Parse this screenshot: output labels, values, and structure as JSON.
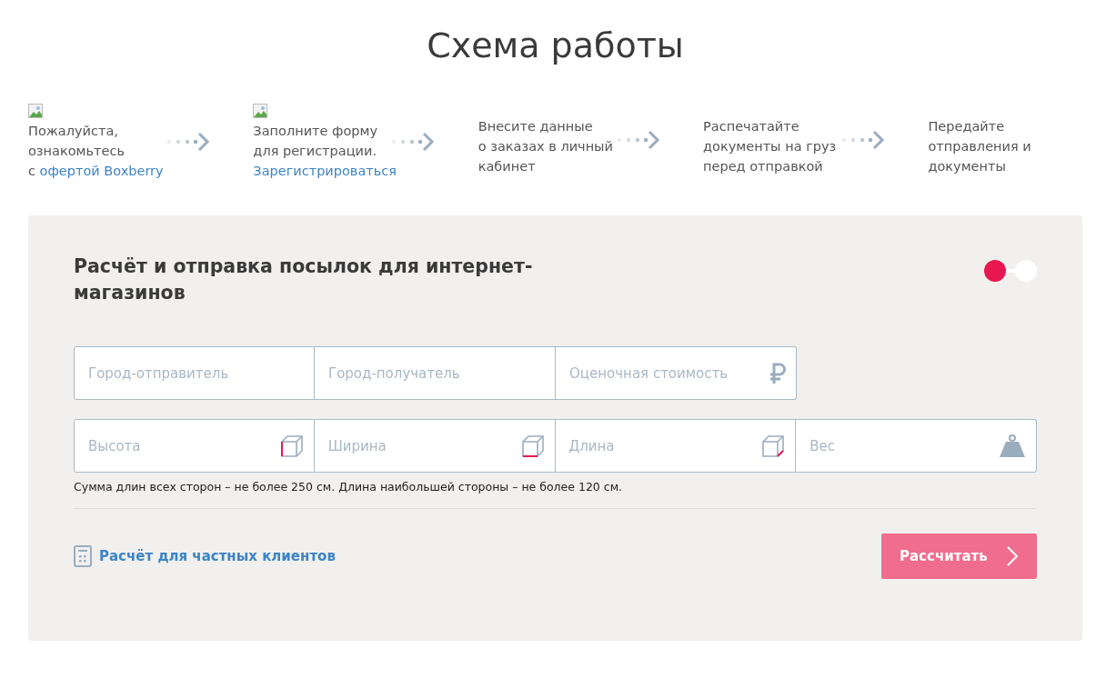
{
  "title": "Схема работы",
  "steps": [
    {
      "image": true,
      "lines": [
        "Пожалуйста,",
        "ознакомьтесь",
        "с"
      ],
      "link": "офертой Boxberry",
      "link_on_new_line": false,
      "arrow": true
    },
    {
      "image": true,
      "lines": [
        "Заполните форму",
        "для регистрации."
      ],
      "link": "Зарегистрироваться",
      "link_on_new_line": true,
      "arrow": true
    },
    {
      "image": false,
      "lines": [
        "Внесите данные",
        "о заказах в личный",
        "кабинет"
      ],
      "arrow": true
    },
    {
      "image": false,
      "lines": [
        "Распечатайте",
        "документы на груз",
        "перед отправкой"
      ],
      "arrow": true
    },
    {
      "image": false,
      "lines": [
        "Передайте",
        "отправления и",
        "документы"
      ],
      "arrow": false
    }
  ],
  "calculator": {
    "heading": "Расчёт и отправка посылок для интернет-магазинов",
    "mode_toggle": [
      {
        "selected": true
      },
      {
        "selected": false
      }
    ],
    "field_rows": [
      [
        {
          "placeholder": "Город-отправитель"
        },
        {
          "placeholder": "Город-получатель"
        },
        {
          "placeholder": "Оценочная стоимость",
          "kind": "ruble"
        }
      ],
      [
        {
          "placeholder": "Высота",
          "kind": "height"
        },
        {
          "placeholder": "Ширина",
          "kind": "width"
        },
        {
          "placeholder": "Длина",
          "kind": "length"
        },
        {
          "placeholder": "Вес",
          "kind": "weight"
        }
      ]
    ],
    "note": "Сумма длин всех сторон – не более 250 см. Длина наибольшей стороны – не более 120 см.",
    "private_link": "Расчёт для частных клиентов",
    "submit_button": "Рассчитать"
  }
}
